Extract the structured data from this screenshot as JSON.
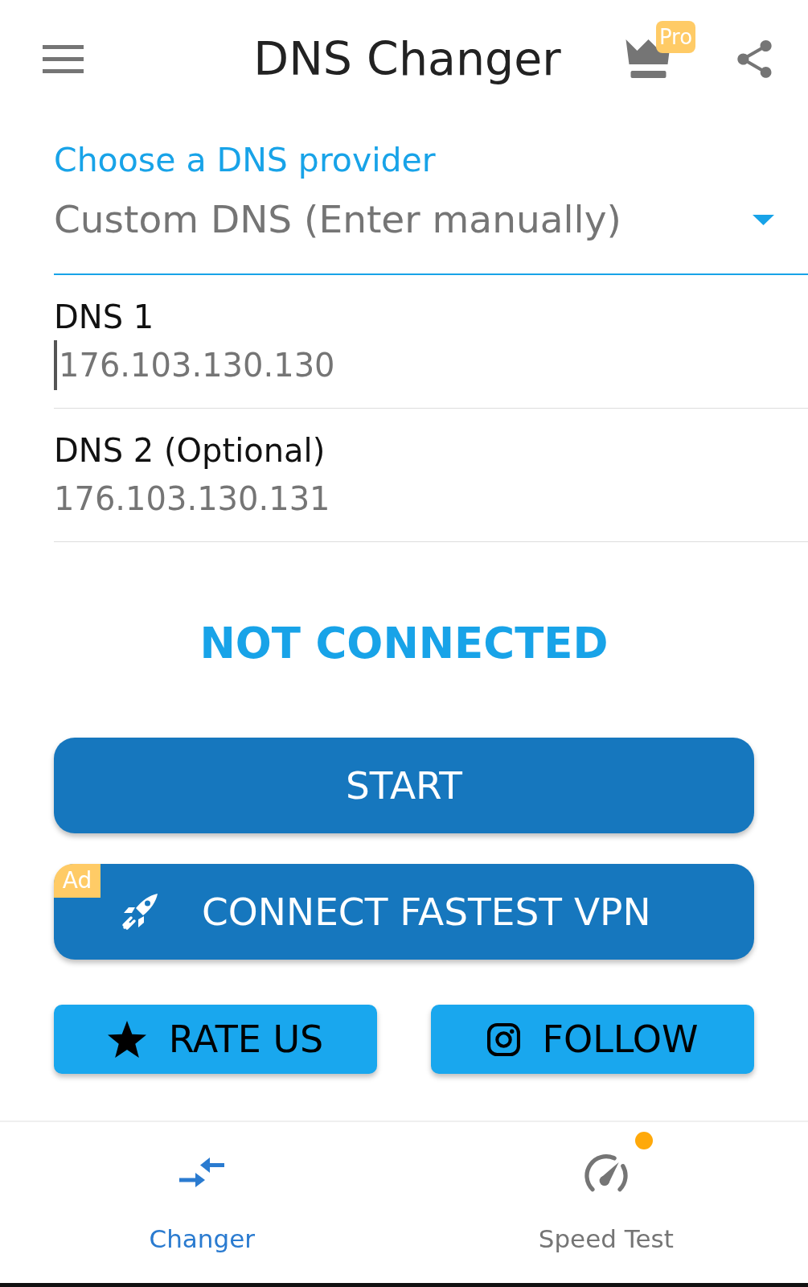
{
  "app_bar": {
    "title": "DNS Changer",
    "pro_badge": "Pro"
  },
  "provider": {
    "label": "Choose a DNS provider",
    "value": "Custom DNS (Enter manually)"
  },
  "fields": [
    {
      "label": "DNS 1",
      "value": "176.103.130.130",
      "focused": true
    },
    {
      "label": "DNS 2 (Optional)",
      "value": "176.103.130.131",
      "focused": false
    }
  ],
  "status": "NOT CONNECTED",
  "start_button": {
    "label": "START"
  },
  "vpn_button": {
    "label": "CONNECT FASTEST VPN",
    "badge": "Ad"
  },
  "action_buttons": [
    {
      "kind": "rate",
      "label": "RATE US"
    },
    {
      "kind": "follow",
      "label": "FOLLOW"
    }
  ],
  "bottom_nav": [
    {
      "kind": "changer",
      "label": "Changer",
      "selected": true,
      "dot": false
    },
    {
      "kind": "speed_test",
      "label": "Speed Test",
      "selected": false,
      "dot": true
    }
  ]
}
